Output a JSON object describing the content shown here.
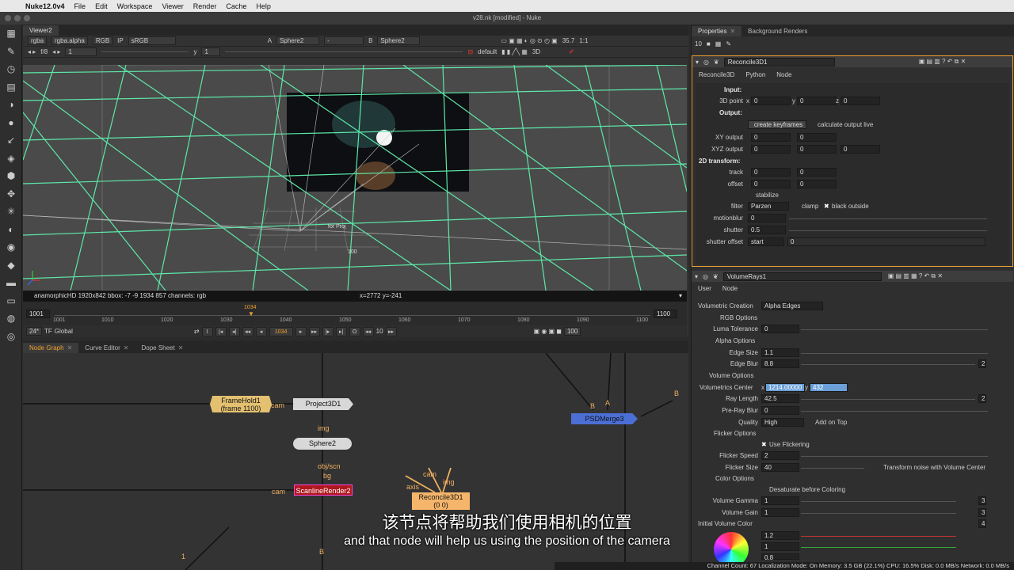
{
  "menubar": {
    "app": "Nuke12.0v4",
    "items": [
      "File",
      "Edit",
      "Workspace",
      "Viewer",
      "Render",
      "Cache",
      "Help"
    ]
  },
  "window_title": "v28.nk [modified] - Nuke",
  "viewer": {
    "tab": "Viewer2",
    "channels": "rgba",
    "alpha": "rgba.alpha",
    "rgb": "RGB",
    "ip": "IP",
    "colorspace": "sRGB",
    "input_a_label": "A",
    "input_a": "Sphere2",
    "dash": "-",
    "input_b_label": "B",
    "input_b": "Sphere2",
    "zoom": "35.7",
    "ratio": "1:1",
    "fstop": "f/8",
    "gain": "1",
    "gamma_label": "y",
    "gamma": "1",
    "view": "default",
    "mode": "3D",
    "grid_label_hd": "for Proj",
    "grid_label_100": "100",
    "info": "anamorphicHD 1920x842  bbox: -7 -9 1934 857 channels: rgb",
    "coords": "x=2772 y=-241"
  },
  "timeline": {
    "start": "1001",
    "end": "1100",
    "current": "1034",
    "ticks": [
      "1001",
      "1010",
      "1020",
      "1030",
      "1040",
      "1050",
      "1060",
      "1070",
      "1080",
      "1090",
      "1100"
    ],
    "end_field": "1100",
    "fps": "24*",
    "tf": "TF",
    "scope": "Global",
    "frame_field": "1034",
    "step": "10",
    "range_end": "100"
  },
  "ngtabs": [
    "Node Graph",
    "Curve Editor",
    "Dope Sheet"
  ],
  "nodes": {
    "framehold": "FrameHold1",
    "framehold_sub": "(frame 1100)",
    "cam1": "cam",
    "project": "Project3D1",
    "img": "img",
    "sphere": "Sphere2",
    "objscn": "obj/scn",
    "bg": "bg",
    "scanline": "ScanlineRender2",
    "cam2": "cam",
    "reconcile": "Reconcile3D1",
    "reconcile_sub": "(0 0)",
    "axis": "axis",
    "cam3": "cam",
    "img2": "img",
    "psd": "PSDMerge3 (normal)",
    "b1": "B",
    "a1": "A",
    "b2": "B",
    "b3": "B",
    "one": "1"
  },
  "props": {
    "tabs": [
      "Properties",
      "Background Renders"
    ],
    "max": "10",
    "reconcile": {
      "name": "Reconcile3D1",
      "tabs": [
        "Reconcile3D",
        "Python",
        "Node"
      ],
      "input": "Input:",
      "point3d": "3D point",
      "x0": "0",
      "y0": "0",
      "z0": "0",
      "output": "Output:",
      "create_keys": "create keyframes",
      "calc_live": "calculate output live",
      "xy_output": "XY output",
      "xyz_output": "XYZ output",
      "transform2d": "2D transform:",
      "track": "track",
      "offset": "offset",
      "stabilize": "stabilize",
      "filter": "filter",
      "filter_val": "Parzen",
      "clamp": "clamp",
      "black_outside": "black outside",
      "motionblur": "motionblur",
      "motionblur_val": "0",
      "shutter": "shutter",
      "shutter_val": "0.5",
      "shutter_offset": "shutter offset",
      "shutter_offset_val": "start",
      "shutter_offset_num": "0",
      "x": "x",
      "y": "y",
      "z": "z"
    },
    "volumerays": {
      "name": "VolumeRays1",
      "tabs": [
        "User",
        "Node"
      ],
      "vol_creation": "Volumetric Creation",
      "vol_creation_val": "Alpha Edges",
      "rgb_options": "RGB Options",
      "luma_tol": "Luma Tolerance",
      "luma_tol_val": "0",
      "alpha_options": "Alpha Options",
      "edge_size": "Edge Size",
      "edge_size_val": "1.1",
      "edge_blur": "Edge Blur",
      "edge_blur_val": "8.8",
      "edge_blur_n": "2",
      "volume_options": "Volume Options",
      "vol_center": "Volumetrics Center",
      "vc_x": "1214.00000",
      "vc_y": "432",
      "ray_length": "Ray Length",
      "ray_length_val": "42.5",
      "ray_n": "2",
      "preray_blur": "Pre-Ray Blur",
      "preray_blur_val": "0",
      "quality": "Quality",
      "quality_val": "High",
      "add_on_top": "Add on Top",
      "flicker_options": "Flicker Options",
      "use_flicker": "Use Flickering",
      "flicker_speed": "Flicker Speed",
      "flicker_speed_val": "2",
      "flicker_size": "Flicker Size",
      "flicker_size_val": "40",
      "transform_noise": "Transform noise with Volume Center",
      "color_options": "Color Options",
      "desaturate": "Desaturate before Coloring",
      "vol_gamma": "Volume Gamma",
      "vol_gamma_val": "1",
      "vol_gamma_n": "3",
      "vol_gain": "Volume Gain",
      "vol_gain_val": "1",
      "vol_gain_n": "3",
      "init_color": "Initial Volume Color",
      "init_n": "4",
      "c1": "1.2",
      "c2": "1",
      "c3": "0.8"
    }
  },
  "status": "Channel Count: 67  Localization Mode: On  Memory: 3.5 GB (22.1%)  CPU: 16.5%  Disk: 0.0 MB/s  Network: 0.0 MB/s",
  "subtitles": {
    "cn": "该节点将帮助我们使用相机的位置",
    "en": "and that node will help us using the position of the camera"
  },
  "colors": {
    "grid": "#5de8a8",
    "node_tan": "#e4c171",
    "node_red": "#b0171d",
    "node_blue": "#4c6fd6",
    "node_orange": "#f5b66b",
    "highlight": "#6a9fd8"
  }
}
